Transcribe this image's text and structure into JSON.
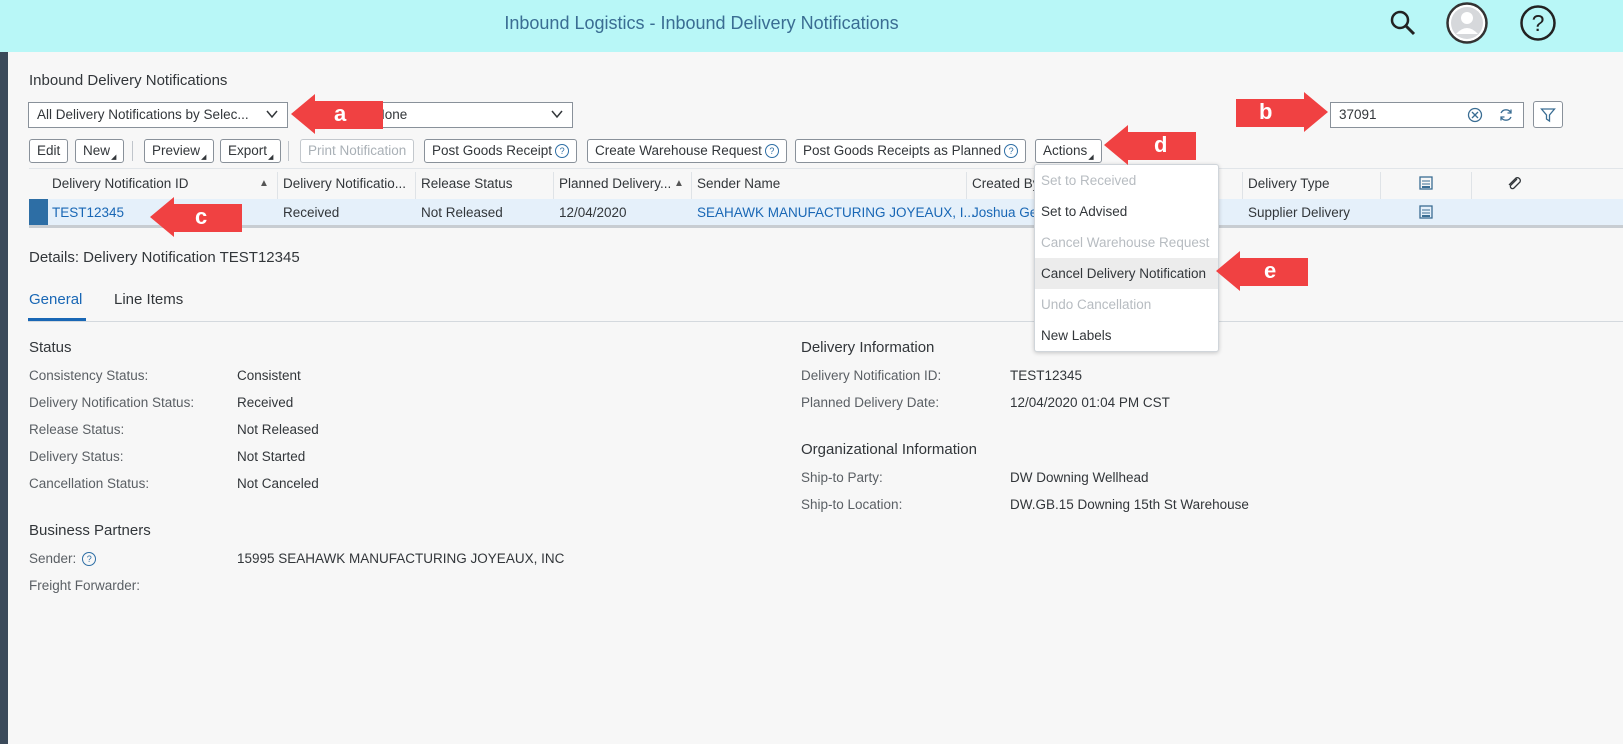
{
  "shell": {
    "title": "Inbound Logistics - Inbound Delivery Notifications"
  },
  "page": {
    "title": "Inbound Delivery Notifications"
  },
  "filters": {
    "variant_value": "All Delivery Notifications by Selec...",
    "second_value": "None",
    "search_value": "37091"
  },
  "toolbar": {
    "edit": "Edit",
    "new": "New",
    "preview": "Preview",
    "export": "Export",
    "print": "Print Notification",
    "post_goods_receipt": "Post Goods Receipt",
    "create_warehouse_request": "Create Warehouse Request",
    "post_goods_receipts_planned": "Post Goods Receipts as Planned",
    "actions": "Actions"
  },
  "table": {
    "headers": [
      "Delivery Notification ID",
      "Delivery Notificatio...",
      "Release Status",
      "Planned Delivery...",
      "Sender Name",
      "Created By",
      "Delivery Type"
    ],
    "row": {
      "id": "TEST12345",
      "status": "Received",
      "release": "Not Released",
      "planned": "12/04/2020",
      "sender": "SEAHAWK MANUFACTURING JOYEAUX, I...",
      "created_by": "Joshua Ge",
      "type": "Supplier Delivery"
    }
  },
  "actions_menu": {
    "items": [
      "Set to Received",
      "Set to Advised",
      "Cancel Warehouse Request",
      "Cancel Delivery Notification",
      "Undo Cancellation",
      "New Labels"
    ]
  },
  "callouts": {
    "a": "a",
    "b": "b",
    "c": "c",
    "d": "d",
    "e": "e"
  },
  "details": {
    "title": "Details: Delivery Notification TEST12345",
    "tabs": [
      "General",
      "Line Items"
    ],
    "status": {
      "heading": "Status",
      "consistency_label": "Consistency Status:",
      "consistency": "Consistent",
      "dn_status_label": "Delivery Notification Status:",
      "dn_status": "Received",
      "release_label": "Release Status:",
      "release": "Not Released",
      "delivery_label": "Delivery Status:",
      "delivery": "Not Started",
      "cancel_label": "Cancellation Status:",
      "cancel": "Not Canceled"
    },
    "partners": {
      "heading": "Business Partners",
      "sender_label": "Sender:",
      "sender": "15995 SEAHAWK MANUFACTURING JOYEAUX, INC",
      "ff_label": "Freight Forwarder:"
    },
    "delivery_info": {
      "heading": "Delivery Information",
      "id_label": "Delivery Notification ID:",
      "id": "TEST12345",
      "date_label": "Planned Delivery Date:",
      "date": "12/04/2020 01:04 PM CST"
    },
    "org_info": {
      "heading": "Organizational Information",
      "ship_party_label": "Ship-to Party:",
      "ship_party": "DW Downing Wellhead",
      "ship_loc_label": "Ship-to Location:",
      "ship_loc": "DW.GB.15 Downing 15th St Warehouse"
    }
  },
  "colors": {
    "shell": "#b8f7f7",
    "link": "#1967b5",
    "callout": "#f04142",
    "row_selected": "#e5f0fa"
  }
}
